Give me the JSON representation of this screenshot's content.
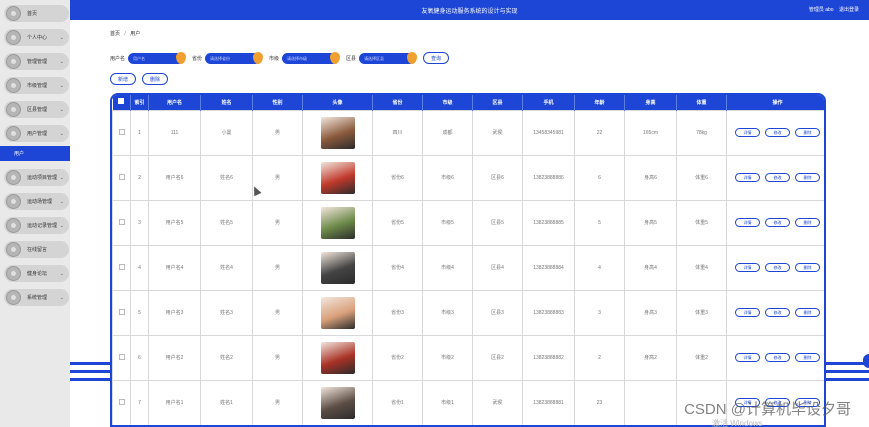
{
  "app": {
    "title": "友氧健身运动服务系统的设计与实现",
    "user_role": "管理员 abo",
    "logout": "退出登录"
  },
  "sidebar": {
    "items": [
      {
        "label": "首页",
        "has_children": false
      },
      {
        "label": "个人中心",
        "has_children": true
      },
      {
        "label": "管理管理",
        "has_children": true
      },
      {
        "label": "市级管理",
        "has_children": true
      },
      {
        "label": "区县管理",
        "has_children": true
      },
      {
        "label": "用户管理",
        "has_children": true
      },
      {
        "label": "运动项目管理",
        "has_children": true
      },
      {
        "label": "运动场管理",
        "has_children": true
      },
      {
        "label": "运动记录管理",
        "has_children": true
      },
      {
        "label": "在线留言",
        "has_children": false
      },
      {
        "label": "健身论坛",
        "has_children": true
      },
      {
        "label": "系统管理",
        "has_children": true
      }
    ],
    "active_sub": "用户"
  },
  "breadcrumb": {
    "home": "首页",
    "separator": "/",
    "current": "用户"
  },
  "search": {
    "fields": [
      {
        "label": "用户名",
        "placeholder": "用户名"
      },
      {
        "label": "省份",
        "placeholder": "请选择省份"
      },
      {
        "label": "市级",
        "placeholder": "请选择市级"
      },
      {
        "label": "区县",
        "placeholder": "请选择区县"
      }
    ],
    "query_button": "查询"
  },
  "actions": {
    "add": "新增",
    "delete": "删除"
  },
  "table": {
    "headers": [
      "索引",
      "用户名",
      "姓名",
      "性别",
      "头像",
      "省份",
      "市级",
      "区县",
      "手机",
      "年龄",
      "身高",
      "体重",
      "操作"
    ],
    "op_labels": {
      "detail": "详情",
      "edit": "修改",
      "delete": "删除"
    },
    "rows": [
      {
        "index": "1",
        "username": "111",
        "name": "小曼",
        "gender": "男",
        "province": "四川",
        "city": "成都",
        "district": "武侯",
        "phone": "13458345981",
        "age": "22",
        "height": "165cm",
        "weight": "78kg",
        "avatar_color": "#8a5a3c"
      },
      {
        "index": "2",
        "username": "用户名6",
        "name": "姓名6",
        "gender": "男",
        "province": "省份6",
        "city": "市级6",
        "district": "区县6",
        "phone": "13823888886",
        "age": "6",
        "height": "身高6",
        "weight": "体重6",
        "avatar_color": "#c0392b"
      },
      {
        "index": "3",
        "username": "用户名5",
        "name": "姓名5",
        "gender": "男",
        "province": "省份5",
        "city": "市级5",
        "district": "区县5",
        "phone": "13823888885",
        "age": "5",
        "height": "身高5",
        "weight": "体重5",
        "avatar_color": "#6d8a4a"
      },
      {
        "index": "4",
        "username": "用户名4",
        "name": "姓名4",
        "gender": "男",
        "province": "省份4",
        "city": "市级4",
        "district": "区县4",
        "phone": "13823888884",
        "age": "4",
        "height": "身高4",
        "weight": "体重4",
        "avatar_color": "#444444"
      },
      {
        "index": "5",
        "username": "用户名3",
        "name": "姓名3",
        "gender": "男",
        "province": "省份3",
        "city": "市级3",
        "district": "区县3",
        "phone": "13823888883",
        "age": "3",
        "height": "身高3",
        "weight": "体重3",
        "avatar_color": "#d9a07a"
      },
      {
        "index": "6",
        "username": "用户名2",
        "name": "姓名2",
        "gender": "男",
        "province": "省份2",
        "city": "市级2",
        "district": "区县2",
        "phone": "13823888882",
        "age": "2",
        "height": "身高2",
        "weight": "体重2",
        "avatar_color": "#a93226"
      },
      {
        "index": "7",
        "username": "用户名1",
        "name": "姓名1",
        "gender": "男",
        "province": "省份1",
        "city": "市级1",
        "district": "武侯",
        "phone": "13823888881",
        "age": "23",
        "height": "",
        "weight": "",
        "avatar_color": "#5d4e46"
      }
    ]
  },
  "overlay": {
    "watermark": "CSDN @计算机毕设夕哥",
    "windows_notice": "激活 Windows"
  },
  "colors": {
    "primary": "#1d46d6",
    "accent": "#f0a030",
    "sidebar_bg": "#e9e9e9"
  }
}
